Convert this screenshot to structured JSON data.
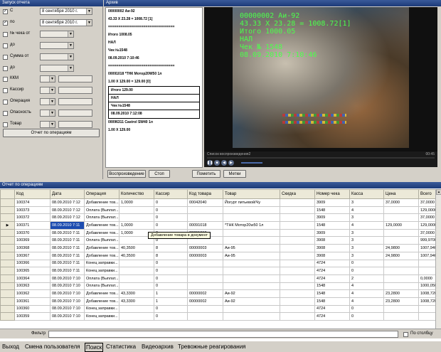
{
  "filter_panel": {
    "title": "Запуск отчета",
    "rows": [
      {
        "label": "С",
        "checked": true,
        "value": "8 сентября 2010 г."
      },
      {
        "label": "по",
        "checked": true,
        "value": "8 сентября 2010 г."
      },
      {
        "label": "№ чека от",
        "checked": false,
        "value": ""
      },
      {
        "label": "до",
        "checked": false,
        "value": ""
      },
      {
        "label": "Сумма от",
        "checked": false,
        "value": ""
      },
      {
        "label": "до",
        "checked": false,
        "value": ""
      },
      {
        "label": "ККМ",
        "checked": false,
        "value": ""
      },
      {
        "label": "Кассир",
        "checked": false,
        "value": ""
      },
      {
        "label": "Операция",
        "checked": false,
        "value": ""
      },
      {
        "label": "Опасность",
        "checked": false,
        "value": ""
      },
      {
        "label": "Товар",
        "checked": false,
        "value": ""
      }
    ],
    "run_button": "Отчет по операциям"
  },
  "archive_panel": {
    "title": "Архив",
    "receipt_lines": [
      "00000002 Аи-92",
      "43.33 X 23.28  = 1008.72 [1]",
      "================================",
      "Итого 1008.05",
      "НАЛ",
      "Чек №1548",
      "08.09.2010 7:10:46",
      "================================",
      "00091018 *ТНК Мотор20W50 1л",
      "1.00 X 129.00  = 129.00 [0]"
    ],
    "receipt_box_lines": [
      "Итого 129.00",
      "НАЛ",
      "Чек №1548",
      "08.09.2010 7:12:08"
    ],
    "receipt_tail_lines": [
      "00096311 Castrol SW40 1л",
      "1.00 X 129.00"
    ],
    "video_overlay": [
      "00000002 Аи-92",
      "43.33 X 23.28  = 1008.72[1]",
      "Итого 1000.05",
      "НАЛ",
      "Чек № 1548",
      "08.09.2010 7:10:46"
    ],
    "video_list_label": "Список воспроизведения2",
    "video_time": "00:45",
    "buttons": {
      "play": "Воспроизведение",
      "stop": "Стоп",
      "next": "Пометить",
      "marks": "Метки"
    }
  },
  "ops_table": {
    "title": "Отчет по операциям",
    "columns": [
      "Код",
      "Дата",
      "Операция",
      "Количество",
      "Кассир",
      "Код товара",
      "Товар",
      "Скидка",
      "Номер чека",
      "Касса",
      "Цена",
      "Всего"
    ],
    "rows": [
      [
        "100374",
        "08.09.2010 7:12",
        "Добавление тов...",
        "1,0000",
        "0",
        "00042040",
        "Йогурт питьевой/Чу",
        "",
        "3909",
        "3",
        "37,0000",
        "37,0000"
      ],
      [
        "100373",
        "08.09.2010 7:12",
        "Оплата (Выплат...",
        "",
        "0",
        "",
        "",
        "",
        "1548",
        "4",
        "",
        "129,0000"
      ],
      [
        "100372",
        "08.09.2010 7:12",
        "Оплата (Выплат...",
        "",
        "0",
        "",
        "",
        "",
        "3909",
        "3",
        "",
        "37,0000"
      ],
      [
        "100371",
        "08.09.2010 7:11",
        "Добавление тов...",
        "1,0000",
        "0",
        "00091018",
        "*ТНК Мотор20w50 1л",
        "",
        "1548",
        "4",
        "129,0000",
        "129,0000"
      ],
      [
        "100370",
        "08.09.2010 7:11",
        "Добавление тов...",
        "1,0000",
        "0",
        "00091018",
        "",
        "",
        "3909",
        "3",
        "",
        "37,0000"
      ],
      [
        "100369",
        "08.09.2010 7:11",
        "Оплата (Выплат...",
        "",
        "0",
        "",
        "",
        "",
        "3908",
        "3",
        "",
        "999,9700"
      ],
      [
        "100368",
        "08.09.2010 7:11",
        "Добавление тов...",
        "40,3500",
        "8",
        "00000003",
        "Аи-95",
        "",
        "3908",
        "3",
        "24,9800",
        "1007,9400"
      ],
      [
        "100367",
        "08.09.2010 7:11",
        "Добавление тов...",
        "40,3500",
        "8",
        "00000003",
        "Аи-95",
        "",
        "3908",
        "3",
        "24,9800",
        "1007,9400"
      ],
      [
        "100366",
        "08.09.2010 7:11",
        "Конец заправки...",
        "",
        "0",
        "",
        "",
        "",
        "4724",
        "0",
        "",
        ""
      ],
      [
        "100365",
        "08.09.2010 7:11",
        "Конец заправки...",
        "",
        "0",
        "",
        "",
        "",
        "4724",
        "0",
        "",
        ""
      ],
      [
        "100364",
        "08.09.2010 7:10",
        "Оплата (Выплат...",
        "",
        "0",
        "",
        "",
        "",
        "4724",
        "2",
        "",
        "0,0000"
      ],
      [
        "100363",
        "08.09.2010 7:10",
        "Оплата (Выплат...",
        "",
        "0",
        "",
        "",
        "",
        "1548",
        "4",
        "",
        "1000,0500"
      ],
      [
        "100362",
        "08.09.2010 7:10",
        "Добавление тов...",
        "43,3300",
        "1",
        "00000002",
        "Аи-92",
        "",
        "1548",
        "4",
        "23,2800",
        "1008,7200"
      ],
      [
        "100361",
        "08.09.2010 7:10",
        "Добавление тов...",
        "43,3300",
        "1",
        "00000002",
        "Аи-92",
        "",
        "1548",
        "4",
        "23,2800",
        "1008,7200"
      ],
      [
        "100360",
        "08.09.2010 7:10",
        "Конец заправки...",
        "",
        "0",
        "",
        "",
        "",
        "4724",
        "0",
        "",
        ""
      ],
      [
        "100359",
        "08.09.2010 7:10",
        "Конец заправки...",
        "",
        "0",
        "",
        "",
        "",
        "4724",
        "0",
        "",
        ""
      ]
    ],
    "tooltip": "Добавление товара в документ"
  },
  "filter_bar": {
    "label": "Фильтр",
    "value": "",
    "by_column": "По столбцу"
  },
  "menu": [
    "Выход",
    "Смена пользователя",
    "Поиск",
    "Статистика",
    "Видеоархив",
    "Тревожные реагирования"
  ],
  "colors": {
    "selection": "#1c4cb0",
    "header": "#1c3a78",
    "overlay_text": "#4cff4c"
  }
}
